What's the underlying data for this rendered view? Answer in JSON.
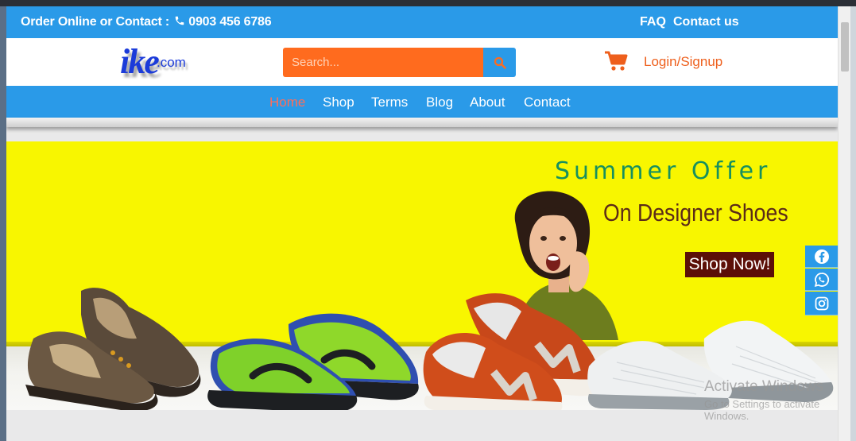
{
  "topbar": {
    "order_text": "Order Online or Contact :",
    "phone": "0903 456 6786",
    "faq": "FAQ",
    "contact": "Contact us"
  },
  "header": {
    "logo_main": "ike",
    "logo_suffix": ".com",
    "search_placeholder": "Search...",
    "login": "Login/Signup"
  },
  "nav": {
    "items": [
      "Home",
      "Shop",
      "Terms",
      "Blog",
      "About",
      "Contact"
    ],
    "active": "Home"
  },
  "hero": {
    "title": "Summer Offer",
    "subtitle": "On Designer Shoes",
    "cta": "Shop Now!"
  },
  "social": [
    "facebook-icon",
    "whatsapp-icon",
    "instagram-icon"
  ],
  "os_watermark": {
    "line1": "Activate Windows",
    "line2": "Go to Settings to activate Windows."
  },
  "colors": {
    "brand_blue": "#2a9ae8",
    "accent_orange": "#ff6b1e",
    "hero_yellow": "#f8f600",
    "cta_maroon": "#5c0f07"
  }
}
